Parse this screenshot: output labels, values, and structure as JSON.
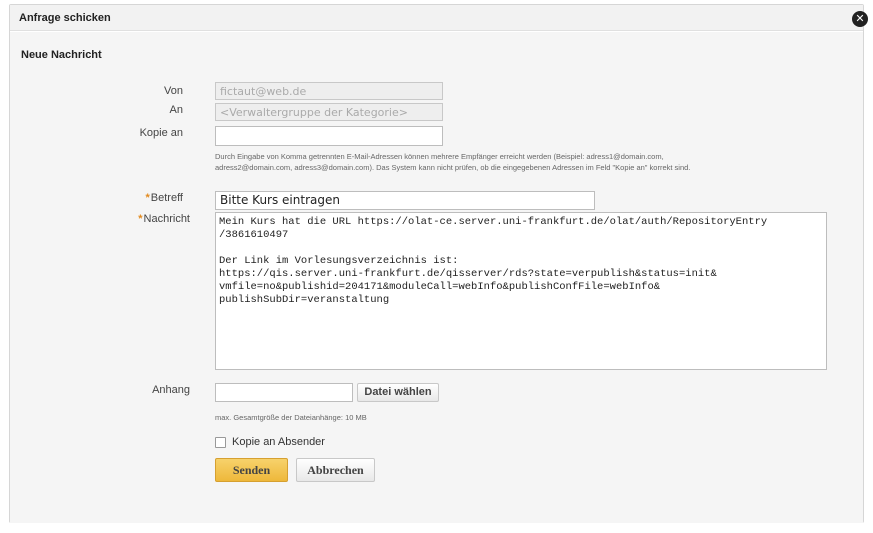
{
  "dialog": {
    "title": "Anfrage schicken",
    "close_glyph": "✕",
    "section_title": "Neue Nachricht"
  },
  "form": {
    "from": {
      "label": "Von",
      "value": "fictaut@web.de"
    },
    "to": {
      "label": "An",
      "value": "<Verwaltergruppe der Kategorie>"
    },
    "cc": {
      "label": "Kopie an",
      "value": "",
      "hint_line1": "Durch Eingabe von Komma getrennten E-Mail-Adressen können mehrere Empfänger erreicht werden (Beispiel: adress1@domain.com,",
      "hint_line2": "adress2@domain.com, adress3@domain.com). Das System kann nicht prüfen, ob die eingegebenen Adressen im Feld \"Kopie an\" korrekt sind."
    },
    "subject": {
      "label": "Betreff",
      "required_mark": "*",
      "value": "Bitte Kurs eintragen"
    },
    "message": {
      "label": "Nachricht",
      "required_mark": "*",
      "value": "Mein Kurs hat die URL https://olat-ce.server.uni-frankfurt.de/olat/auth/RepositoryEntry\n/3861610497\n\nDer Link im Vorlesungsverzeichnis ist:\nhttps://qis.server.uni-frankfurt.de/qisserver/rds?state=verpublish&status=init&\nvmfile=no&publishid=204171&moduleCall=webInfo&publishConfFile=webInfo&\npublishSubDir=veranstaltung"
    },
    "attachment": {
      "label": "Anhang",
      "value": "",
      "choose_file_label": "Datei wählen",
      "size_hint": "max. Gesamtgröße der Dateianhänge: 10 MB"
    },
    "copy_to_sender": {
      "label": "Kopie an Absender",
      "checked": false
    }
  },
  "actions": {
    "send_label": "Senden",
    "cancel_label": "Abbrechen"
  },
  "colors": {
    "primary_button": "#eeb83b",
    "required_marker": "#e28a1e",
    "header_background": "#f2f2f2"
  }
}
